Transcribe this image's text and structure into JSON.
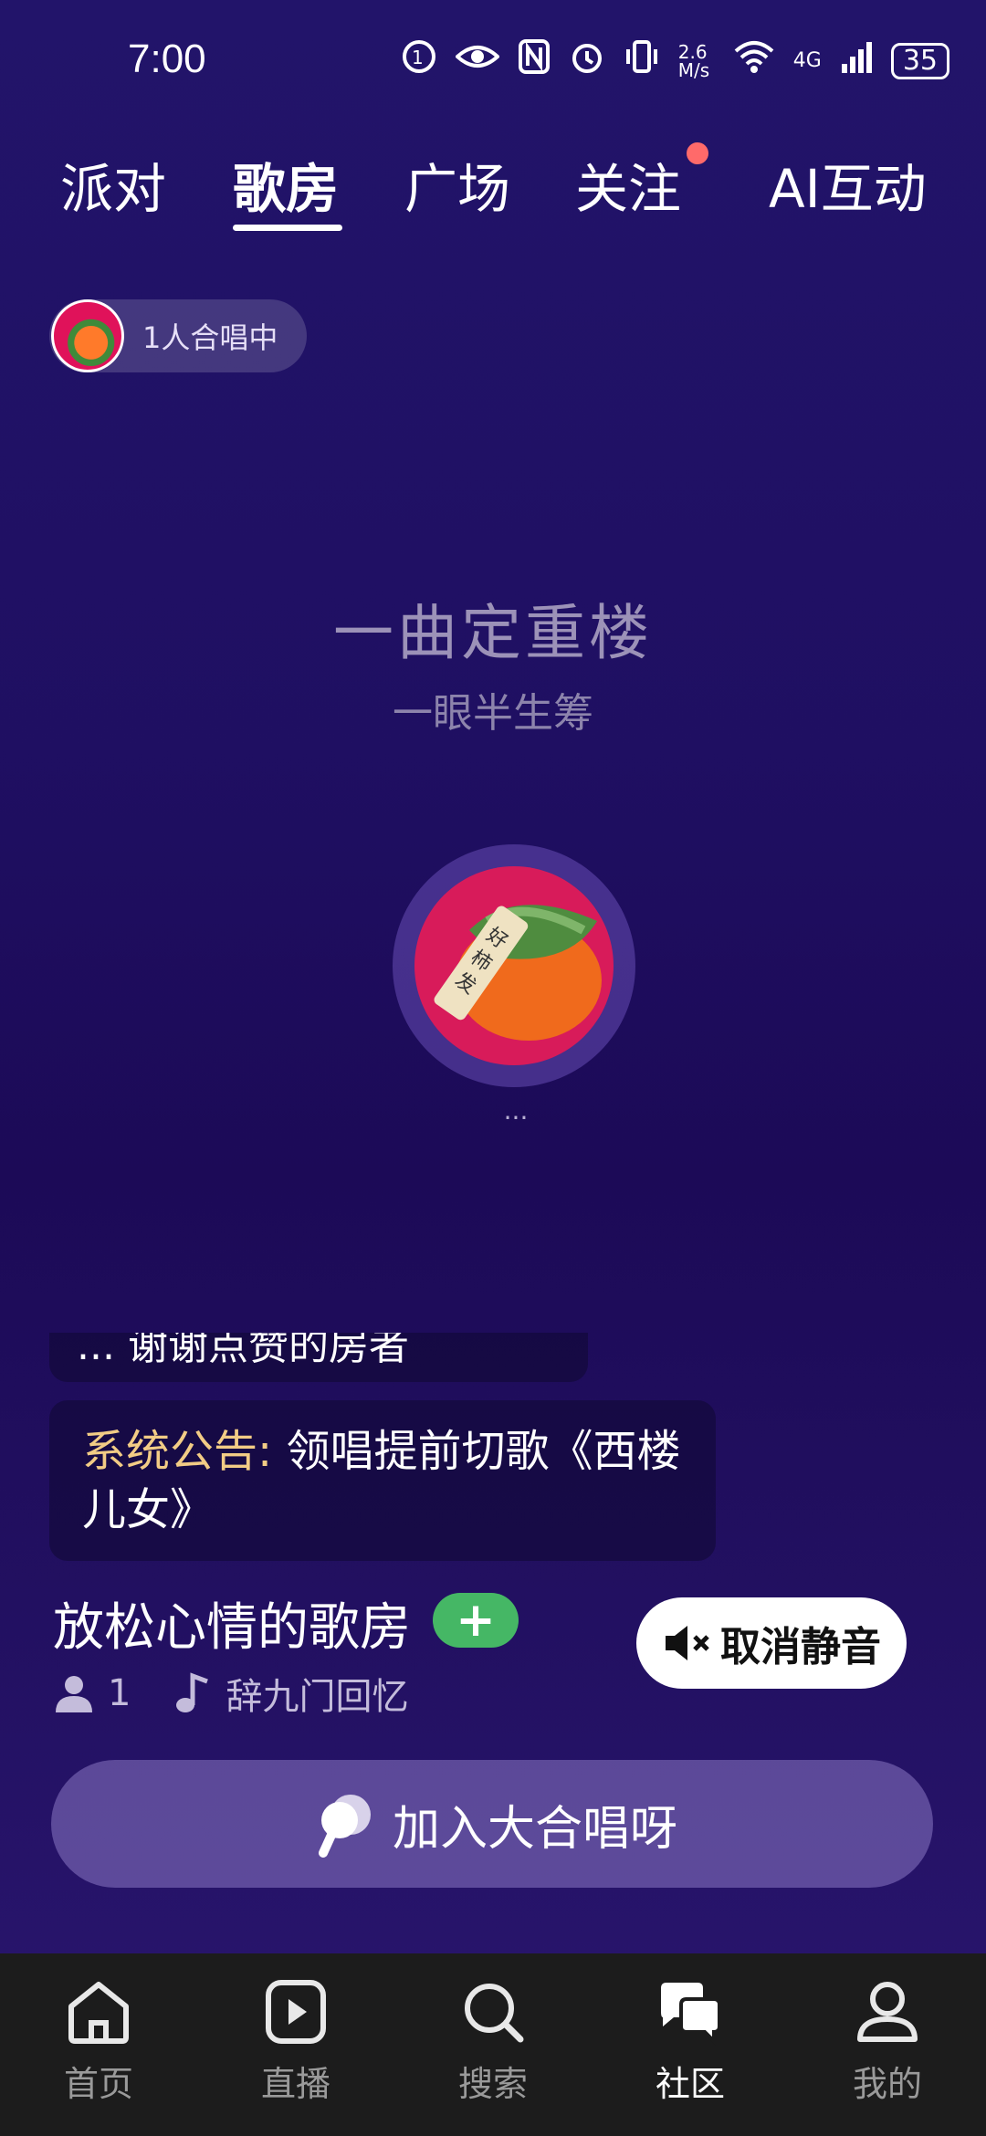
{
  "status_bar": {
    "time": "7:00",
    "net_speed": "2.6 M/s",
    "network": "4G",
    "battery": "35",
    "icons": [
      "notification-icon",
      "eye-icon",
      "nfc-icon",
      "alarm-icon",
      "vibrate-icon",
      "wifi-icon",
      "signal-icon",
      "battery-icon"
    ]
  },
  "tabs": [
    {
      "label": "派对"
    },
    {
      "label": "歌房"
    },
    {
      "label": "广场"
    },
    {
      "label": "关注"
    },
    {
      "label": "AI互动"
    }
  ],
  "active_tab": "歌房",
  "chorus_pill": {
    "label": "1人合唱中"
  },
  "main": {
    "title": "一曲定重楼",
    "subtitle": "一眼半生筹",
    "ellipsis": "..."
  },
  "messages": [
    {
      "partial_text": "... 谢谢点赞的房者"
    },
    {
      "label": "系统公告:",
      "text": " 领唱提前切歌《西楼儿女》"
    }
  ],
  "room": {
    "name": "放松心情的歌房",
    "add_label": "+",
    "member_count": "1",
    "song_owner": "辞九门回忆"
  },
  "unmute_button": {
    "label": "取消静音"
  },
  "join_button": {
    "label": "加入大合唱呀"
  },
  "bottom_nav": [
    {
      "label": "首页",
      "icon": "home-icon"
    },
    {
      "label": "直播",
      "icon": "play-icon"
    },
    {
      "label": "搜索",
      "icon": "search-icon"
    },
    {
      "label": "社区",
      "icon": "chat-icon"
    },
    {
      "label": "我的",
      "icon": "profile-icon"
    }
  ],
  "colors": {
    "accent_green": "#45b765",
    "system_label": "#f2cc85",
    "badge_red": "#ff6a6a"
  }
}
